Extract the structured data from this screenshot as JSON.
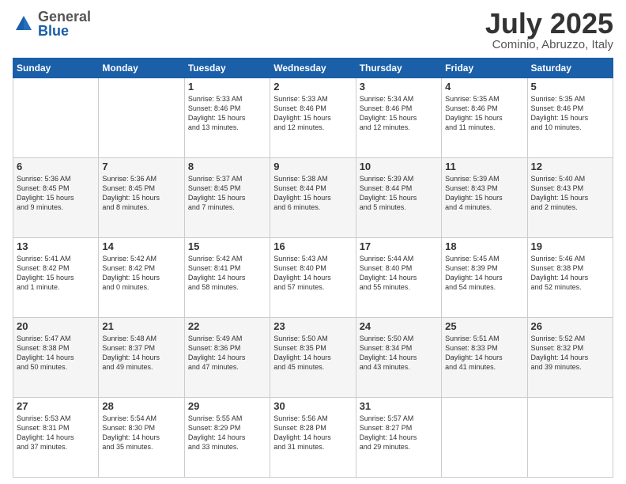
{
  "header": {
    "logo": {
      "general": "General",
      "blue": "Blue"
    },
    "title": "July 2025",
    "location": "Cominio, Abruzzo, Italy"
  },
  "weekdays": [
    "Sunday",
    "Monday",
    "Tuesday",
    "Wednesday",
    "Thursday",
    "Friday",
    "Saturday"
  ],
  "weeks": [
    [
      {
        "day": "",
        "info": ""
      },
      {
        "day": "",
        "info": ""
      },
      {
        "day": "1",
        "info": "Sunrise: 5:33 AM\nSunset: 8:46 PM\nDaylight: 15 hours\nand 13 minutes."
      },
      {
        "day": "2",
        "info": "Sunrise: 5:33 AM\nSunset: 8:46 PM\nDaylight: 15 hours\nand 12 minutes."
      },
      {
        "day": "3",
        "info": "Sunrise: 5:34 AM\nSunset: 8:46 PM\nDaylight: 15 hours\nand 12 minutes."
      },
      {
        "day": "4",
        "info": "Sunrise: 5:35 AM\nSunset: 8:46 PM\nDaylight: 15 hours\nand 11 minutes."
      },
      {
        "day": "5",
        "info": "Sunrise: 5:35 AM\nSunset: 8:46 PM\nDaylight: 15 hours\nand 10 minutes."
      }
    ],
    [
      {
        "day": "6",
        "info": "Sunrise: 5:36 AM\nSunset: 8:45 PM\nDaylight: 15 hours\nand 9 minutes."
      },
      {
        "day": "7",
        "info": "Sunrise: 5:36 AM\nSunset: 8:45 PM\nDaylight: 15 hours\nand 8 minutes."
      },
      {
        "day": "8",
        "info": "Sunrise: 5:37 AM\nSunset: 8:45 PM\nDaylight: 15 hours\nand 7 minutes."
      },
      {
        "day": "9",
        "info": "Sunrise: 5:38 AM\nSunset: 8:44 PM\nDaylight: 15 hours\nand 6 minutes."
      },
      {
        "day": "10",
        "info": "Sunrise: 5:39 AM\nSunset: 8:44 PM\nDaylight: 15 hours\nand 5 minutes."
      },
      {
        "day": "11",
        "info": "Sunrise: 5:39 AM\nSunset: 8:43 PM\nDaylight: 15 hours\nand 4 minutes."
      },
      {
        "day": "12",
        "info": "Sunrise: 5:40 AM\nSunset: 8:43 PM\nDaylight: 15 hours\nand 2 minutes."
      }
    ],
    [
      {
        "day": "13",
        "info": "Sunrise: 5:41 AM\nSunset: 8:42 PM\nDaylight: 15 hours\nand 1 minute."
      },
      {
        "day": "14",
        "info": "Sunrise: 5:42 AM\nSunset: 8:42 PM\nDaylight: 15 hours\nand 0 minutes."
      },
      {
        "day": "15",
        "info": "Sunrise: 5:42 AM\nSunset: 8:41 PM\nDaylight: 14 hours\nand 58 minutes."
      },
      {
        "day": "16",
        "info": "Sunrise: 5:43 AM\nSunset: 8:40 PM\nDaylight: 14 hours\nand 57 minutes."
      },
      {
        "day": "17",
        "info": "Sunrise: 5:44 AM\nSunset: 8:40 PM\nDaylight: 14 hours\nand 55 minutes."
      },
      {
        "day": "18",
        "info": "Sunrise: 5:45 AM\nSunset: 8:39 PM\nDaylight: 14 hours\nand 54 minutes."
      },
      {
        "day": "19",
        "info": "Sunrise: 5:46 AM\nSunset: 8:38 PM\nDaylight: 14 hours\nand 52 minutes."
      }
    ],
    [
      {
        "day": "20",
        "info": "Sunrise: 5:47 AM\nSunset: 8:38 PM\nDaylight: 14 hours\nand 50 minutes."
      },
      {
        "day": "21",
        "info": "Sunrise: 5:48 AM\nSunset: 8:37 PM\nDaylight: 14 hours\nand 49 minutes."
      },
      {
        "day": "22",
        "info": "Sunrise: 5:49 AM\nSunset: 8:36 PM\nDaylight: 14 hours\nand 47 minutes."
      },
      {
        "day": "23",
        "info": "Sunrise: 5:50 AM\nSunset: 8:35 PM\nDaylight: 14 hours\nand 45 minutes."
      },
      {
        "day": "24",
        "info": "Sunrise: 5:50 AM\nSunset: 8:34 PM\nDaylight: 14 hours\nand 43 minutes."
      },
      {
        "day": "25",
        "info": "Sunrise: 5:51 AM\nSunset: 8:33 PM\nDaylight: 14 hours\nand 41 minutes."
      },
      {
        "day": "26",
        "info": "Sunrise: 5:52 AM\nSunset: 8:32 PM\nDaylight: 14 hours\nand 39 minutes."
      }
    ],
    [
      {
        "day": "27",
        "info": "Sunrise: 5:53 AM\nSunset: 8:31 PM\nDaylight: 14 hours\nand 37 minutes."
      },
      {
        "day": "28",
        "info": "Sunrise: 5:54 AM\nSunset: 8:30 PM\nDaylight: 14 hours\nand 35 minutes."
      },
      {
        "day": "29",
        "info": "Sunrise: 5:55 AM\nSunset: 8:29 PM\nDaylight: 14 hours\nand 33 minutes."
      },
      {
        "day": "30",
        "info": "Sunrise: 5:56 AM\nSunset: 8:28 PM\nDaylight: 14 hours\nand 31 minutes."
      },
      {
        "day": "31",
        "info": "Sunrise: 5:57 AM\nSunset: 8:27 PM\nDaylight: 14 hours\nand 29 minutes."
      },
      {
        "day": "",
        "info": ""
      },
      {
        "day": "",
        "info": ""
      }
    ]
  ]
}
